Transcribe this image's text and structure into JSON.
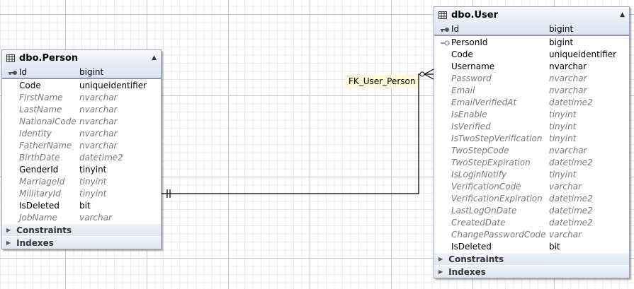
{
  "person": {
    "title": "dbo.Person",
    "columns": [
      {
        "name": "Id",
        "type": "bigint"
      },
      {
        "name": "Code",
        "type": "uniqueidentifier"
      },
      {
        "name": "FirstName",
        "type": "nvarchar"
      },
      {
        "name": "LastName",
        "type": "nvarchar"
      },
      {
        "name": "NationalCode",
        "type": "nvarchar"
      },
      {
        "name": "Identity",
        "type": "nvarchar"
      },
      {
        "name": "FatherName",
        "type": "nvarchar"
      },
      {
        "name": "BirthDate",
        "type": "datetime2"
      },
      {
        "name": "GenderId",
        "type": "tinyint"
      },
      {
        "name": "MarriageId",
        "type": "tinyint"
      },
      {
        "name": "MillitaryId",
        "type": "tinyint"
      },
      {
        "name": "IsDeleted",
        "type": "bit"
      },
      {
        "name": "JobName",
        "type": "varchar"
      }
    ],
    "sections": [
      "Constraints",
      "Indexes"
    ]
  },
  "user": {
    "title": "dbo.User",
    "columns": [
      {
        "name": "Id",
        "type": "bigint"
      },
      {
        "name": "PersonId",
        "type": "bigint"
      },
      {
        "name": "Code",
        "type": "uniqueidentifier"
      },
      {
        "name": "Username",
        "type": "nvarchar"
      },
      {
        "name": "Password",
        "type": "nvarchar"
      },
      {
        "name": "Email",
        "type": "nvarchar"
      },
      {
        "name": "EmailVerifiedAt",
        "type": "datetime2"
      },
      {
        "name": "IsEnable",
        "type": "tinyint"
      },
      {
        "name": "IsVerified",
        "type": "tinyint"
      },
      {
        "name": "IsTwoStepVerification",
        "type": "tinyint"
      },
      {
        "name": "TwoStepCode",
        "type": "nvarchar"
      },
      {
        "name": "TwoStepExpiration",
        "type": "datetime2"
      },
      {
        "name": "IsLoginNotify",
        "type": "tinyint"
      },
      {
        "name": "VerificationCode",
        "type": "varchar"
      },
      {
        "name": "VerificationExpiration",
        "type": "datetime2"
      },
      {
        "name": "LastLogOnDate",
        "type": "datetime2"
      },
      {
        "name": "CreatedDate",
        "type": "datetime2"
      },
      {
        "name": "ChangePasswordCode",
        "type": "varchar"
      },
      {
        "name": "IsDeleted",
        "type": "bit"
      }
    ],
    "sections": [
      "Constraints",
      "Indexes"
    ]
  },
  "relationship": {
    "label": "FK_User_Person"
  }
}
